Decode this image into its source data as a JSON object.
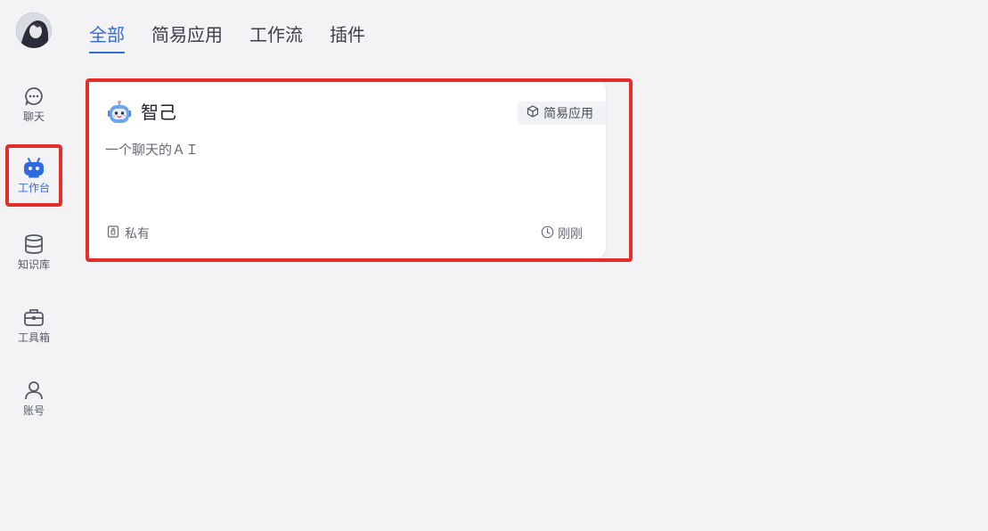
{
  "sidebar": {
    "items": [
      {
        "label": "聊天",
        "icon": "chat-bubble-icon"
      },
      {
        "label": "工作台",
        "icon": "robot-icon",
        "active": true
      },
      {
        "label": "知识库",
        "icon": "database-icon"
      },
      {
        "label": "工具箱",
        "icon": "toolbox-icon"
      },
      {
        "label": "账号",
        "icon": "user-icon"
      }
    ]
  },
  "tabs": [
    {
      "label": "全部",
      "active": true
    },
    {
      "label": "简易应用"
    },
    {
      "label": "工作流"
    },
    {
      "label": "插件"
    }
  ],
  "cards": [
    {
      "title": "智己",
      "type_label": "简易应用",
      "description": "一个聊天的ＡＩ",
      "visibility": "私有",
      "updated": "刚刚"
    }
  ],
  "colors": {
    "accent": "#2f6bde",
    "highlight_border": "#e52e2a",
    "background": "#f3f3f6"
  }
}
